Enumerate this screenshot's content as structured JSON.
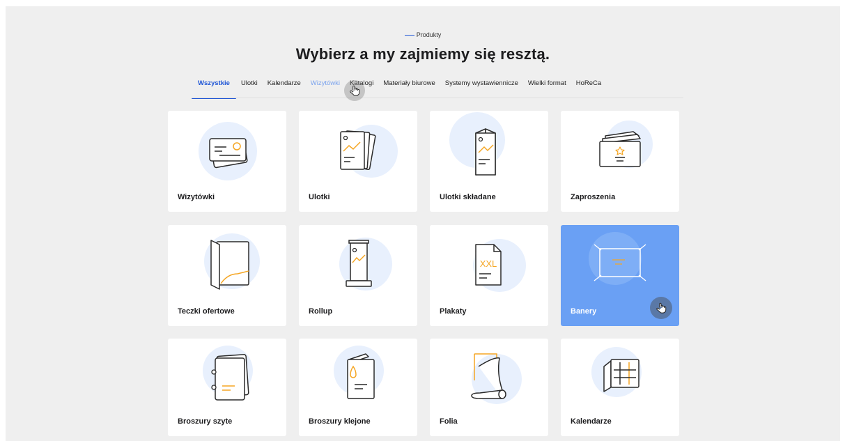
{
  "header": {
    "eyebrow": "Produkty",
    "title": "Wybierz a my zajmiemy się resztą."
  },
  "tabs": [
    {
      "label": "Wszystkie",
      "state": "active"
    },
    {
      "label": "Ulotki",
      "state": "normal"
    },
    {
      "label": "Kalendarze",
      "state": "normal"
    },
    {
      "label": "Wizytówki",
      "state": "hover"
    },
    {
      "label": "Katalogi",
      "state": "normal"
    },
    {
      "label": "Materiały biurowe",
      "state": "normal"
    },
    {
      "label": "Systemy wystawiennicze",
      "state": "normal"
    },
    {
      "label": "Wielki format",
      "state": "normal"
    },
    {
      "label": "HoReCa",
      "state": "normal"
    }
  ],
  "products": [
    {
      "label": "Wizytówki",
      "icon": "business-cards-icon"
    },
    {
      "label": "Ulotki",
      "icon": "flyers-icon"
    },
    {
      "label": "Ulotki składane",
      "icon": "folded-flyer-icon"
    },
    {
      "label": "Zaproszenia",
      "icon": "invitation-icon"
    },
    {
      "label": "Teczki ofertowe",
      "icon": "folder-icon"
    },
    {
      "label": "Rollup",
      "icon": "rollup-icon"
    },
    {
      "label": "Plakaty",
      "icon": "poster-icon"
    },
    {
      "label": "Banery",
      "icon": "banner-icon",
      "selected": true
    },
    {
      "label": "Broszury szyte",
      "icon": "stitched-brochure-icon"
    },
    {
      "label": "Broszury klejone",
      "icon": "glued-brochure-icon"
    },
    {
      "label": "Folia",
      "icon": "foil-roll-icon"
    },
    {
      "label": "Kalendarze",
      "icon": "calendar-icon"
    }
  ],
  "poster_text": "XXL",
  "colors": {
    "accent": "#1f56d6",
    "hover_tab": "#7aa3ee",
    "selected_card": "#6aa0f4",
    "icon_blob": "#e8f0fd",
    "icon_line": "#2a2a2a",
    "icon_highlight": "#f5a623",
    "background": "#efefef"
  }
}
